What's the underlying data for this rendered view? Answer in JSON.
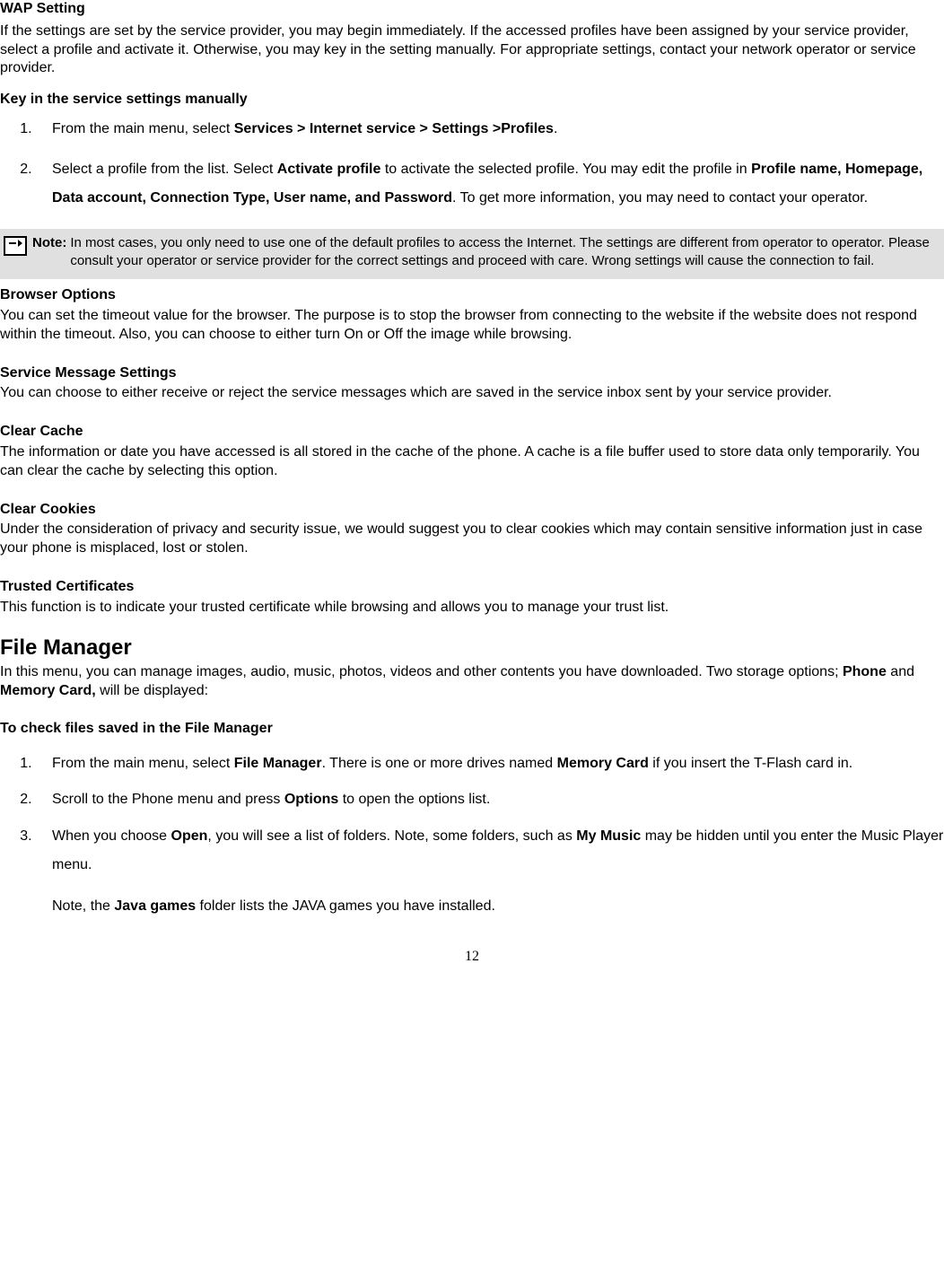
{
  "wap": {
    "heading": "WAP Setting",
    "intro": "If the settings are set by the service provider, you may begin immediately. If the accessed profiles have been assigned by your service provider, select a profile and activate it. Otherwise, you may key in the setting manually. For appropriate settings, contact your network operator or service provider.",
    "manual_heading": "Key in the service settings manually",
    "step1_prefix": "From the main menu, select ",
    "step1_bold": "Services > Internet service > Settings >Profiles",
    "step1_suffix": ".",
    "step2_prefix": "Select a profile from the list. Select ",
    "step2_bold1": "Activate profile",
    "step2_mid": " to activate the selected profile. You may edit the profile in ",
    "step2_bold2": "Profile name, Homepage, Data account, Connection Type, User name, and Password",
    "step2_suffix": ". To get more information, you may need to contact your operator."
  },
  "note": {
    "label": "Note",
    "colon": ":",
    "text": "In most cases, you only need to use one of the default profiles to access the Internet. The settings are different from operator to operator. Please consult your operator or service provider for the correct settings and proceed with care. Wrong settings will cause the connection to fail."
  },
  "browser": {
    "heading": "Browser Options",
    "body": "You can set the timeout value for the browser. The purpose is to stop the browser from connecting to the website if the website does not respond within the timeout. Also, you can choose to either turn On or Off the image while browsing."
  },
  "service_msg": {
    "heading": "Service Message Settings",
    "body": "You can choose to either receive or reject the service messages which are saved in the service inbox sent by your service provider."
  },
  "clear_cache": {
    "heading": "Clear Cache",
    "body": "The information or date you have accessed is all stored in the cache of the phone. A cache is a file buffer used to store data only temporarily. You can clear the cache by selecting this option."
  },
  "clear_cookies": {
    "heading": "Clear Cookies",
    "body": "Under the consideration of privacy and security issue, we would suggest you to clear cookies which may contain sensitive information just in case your phone is misplaced, lost or stolen."
  },
  "trusted": {
    "heading": "Trusted Certificates",
    "body": "This function is to indicate your trusted certificate while browsing and allows you to manage your trust list."
  },
  "file_manager": {
    "heading": "File Manager",
    "intro_prefix": "In this menu, you can manage images, audio, music, photos, videos and other contents you have downloaded. Two storage options; ",
    "intro_bold1": "Phone",
    "intro_mid": " and ",
    "intro_bold2": "Memory Card,",
    "intro_suffix": " will be displayed:",
    "check_heading": "To check files saved in the File Manager",
    "step1_prefix": "From the main menu, select ",
    "step1_bold1": "File Manager",
    "step1_mid": ". There is one or more drives named ",
    "step1_bold2": "Memory Card",
    "step1_suffix": " if you insert the T-Flash card in.",
    "step2_prefix": "Scroll to the Phone menu and press ",
    "step2_bold": "Options",
    "step2_suffix": " to open the options list.",
    "step3_prefix": "When you choose ",
    "step3_bold1": "Open",
    "step3_mid": ", you will see a list of folders. Note, some folders, such as ",
    "step3_bold2": "My Music",
    "step3_suffix": " may be hidden until you enter the Music Player menu.",
    "step3_note_prefix": "Note, the ",
    "step3_note_bold": "Java games",
    "step3_note_suffix": " folder lists the JAVA games you have installed."
  },
  "page_number": "12"
}
